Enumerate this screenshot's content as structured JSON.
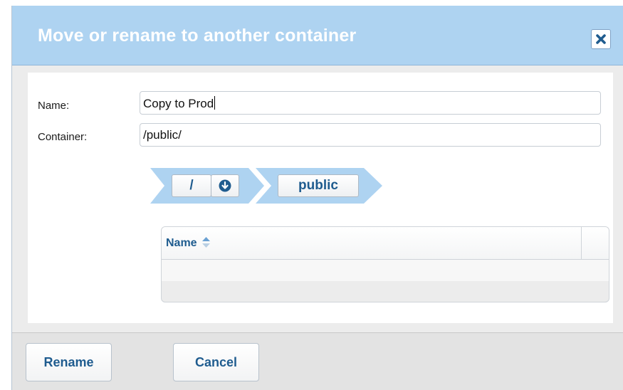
{
  "dialog": {
    "title": "Move or rename to another container",
    "close_icon": "close-icon"
  },
  "form": {
    "name_label": "Name:",
    "name_value": "Copy to Prod",
    "container_label": "Container:",
    "container_value": "/public/"
  },
  "breadcrumb": {
    "items": [
      {
        "label": "/",
        "has_dropdown": true,
        "dropdown_icon": "arrow-down-circle-icon"
      },
      {
        "label": "public",
        "has_dropdown": false
      }
    ]
  },
  "grid": {
    "columns": [
      {
        "label": "Name",
        "sort": "ascending",
        "sort_icon": "sort-icon"
      }
    ],
    "rows": []
  },
  "footer": {
    "rename_label": "Rename",
    "cancel_label": "Cancel"
  },
  "colors": {
    "titlebar": "#aed3f1",
    "accent_text": "#1f5c8f",
    "breadcrumb_arrow": "#aed3f1"
  }
}
